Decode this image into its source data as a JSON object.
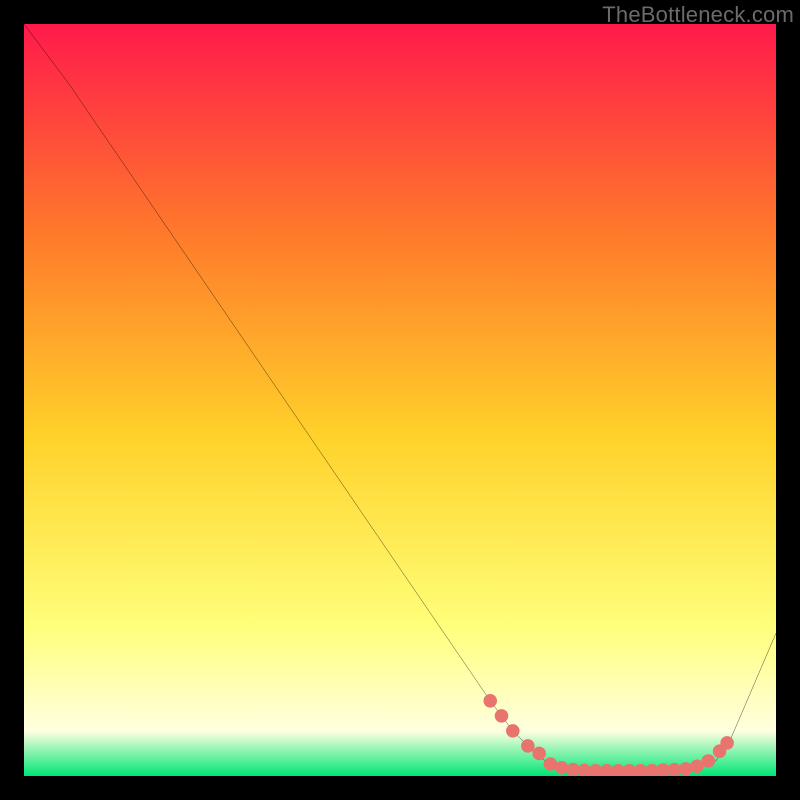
{
  "watermark": "TheBottleneck.com",
  "colors": {
    "page_bg": "#000000",
    "grad_top": "#ff1a4b",
    "grad_mid_upper": "#ff7a2b",
    "grad_mid": "#ffd22a",
    "grad_mid_lower": "#ffff7a",
    "grad_pale": "#ffffe0",
    "grad_bottom": "#00e676",
    "curve": "#000000",
    "marker": "#e9736d"
  },
  "chart_data": {
    "type": "line",
    "title": "",
    "xlabel": "",
    "ylabel": "",
    "xlim": [
      0,
      100
    ],
    "ylim": [
      0,
      100
    ],
    "grid": false,
    "legend": false,
    "series": [
      {
        "name": "bottleneck-curve",
        "x": [
          0,
          6,
          62,
          65,
          68,
          70,
          72,
          76,
          80,
          84,
          88,
          92,
          94,
          100
        ],
        "y": [
          100,
          92,
          10,
          6,
          3,
          1.5,
          0.9,
          0.7,
          0.7,
          0.7,
          0.9,
          2,
          5,
          19
        ]
      }
    ],
    "markers": {
      "name": "highlight-dots",
      "x": [
        62,
        63.5,
        65,
        67,
        68.5,
        70,
        71.5,
        73,
        74.5,
        76,
        77.5,
        79,
        80.5,
        82,
        83.5,
        85,
        86.5,
        88,
        89.5,
        91,
        92.5,
        93.5
      ],
      "y": [
        10,
        8,
        6,
        4,
        3,
        1.6,
        1.1,
        0.85,
        0.75,
        0.7,
        0.7,
        0.7,
        0.7,
        0.7,
        0.72,
        0.78,
        0.85,
        0.95,
        1.3,
        2,
        3.3,
        4.4
      ]
    }
  }
}
